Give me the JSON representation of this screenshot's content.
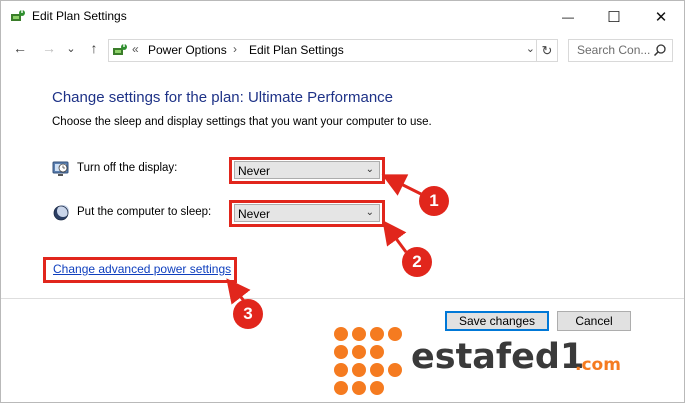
{
  "window": {
    "title": "Edit Plan Settings",
    "controls": {
      "minimize": "—",
      "maximize": "☐",
      "close": "✕"
    }
  },
  "nav": {
    "back": "←",
    "forward": "→",
    "recent": "⌄",
    "up": "↑",
    "overflow": "«",
    "breadcrumbs": [
      "Power Options",
      "Edit Plan Settings"
    ],
    "separator": "›",
    "search_placeholder": "Search Con...",
    "refresh": "↻",
    "dropdown": "⌄"
  },
  "main": {
    "heading": "Change settings for the plan: Ultimate Performance",
    "subtext": "Choose the sleep and display settings that you want your computer to use.",
    "rows": [
      {
        "label": "Turn off the display:",
        "value": "Never",
        "icon": "monitor-icon"
      },
      {
        "label": "Put the computer to sleep:",
        "value": "Never",
        "icon": "moon-icon"
      }
    ],
    "advanced_link": "Change advanced power settings"
  },
  "buttons": {
    "save": "Save changes",
    "cancel": "Cancel"
  },
  "annotations": {
    "badges": [
      "1",
      "2",
      "3"
    ],
    "color": "#e1261c"
  },
  "watermark": {
    "name": "estafed1",
    "suffix": ".com",
    "dot_color": "#f57b20"
  }
}
